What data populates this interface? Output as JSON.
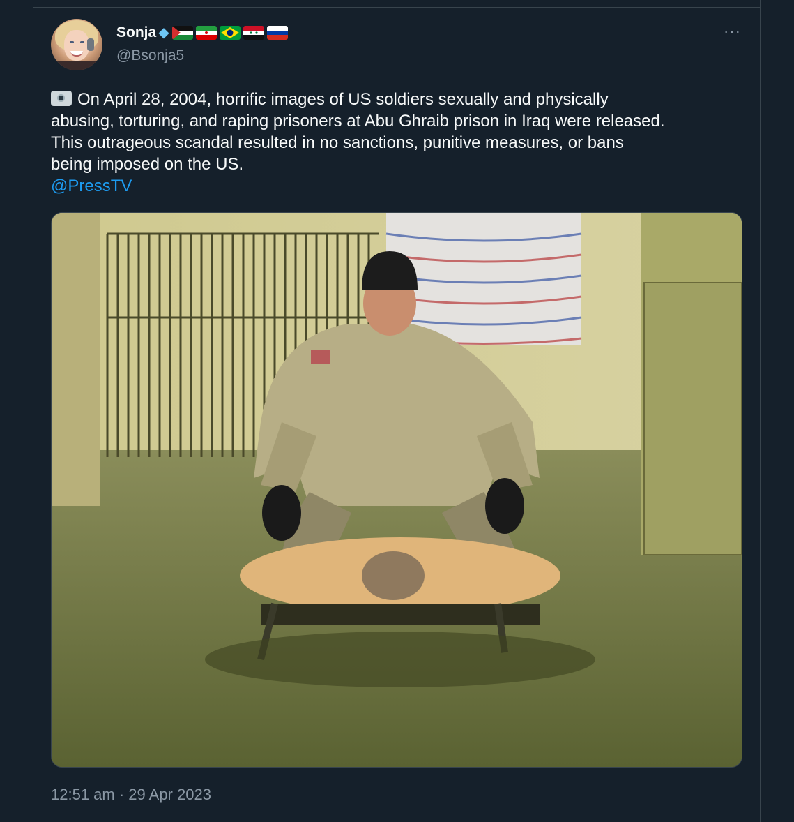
{
  "author": {
    "name": "Sonja",
    "handle": "@Bsonja5"
  },
  "more_button": "···",
  "tweet": {
    "lines": [
      "On April 28, 2004, horrific images of US soldiers sexually and physically",
      "abusing, torturing, and raping prisoners at Abu Ghraib prison in Iraq were released.",
      "This outrageous scandal resulted in no sanctions, punitive measures, or bans",
      "being imposed on the US."
    ],
    "mention": "@PressTV",
    "leading_icon": "camera-icon"
  },
  "timestamp": "12:51 am · 29 Apr 2023",
  "colors": {
    "background": "#15202b",
    "text": "#f7f9f9",
    "muted": "#8b98a5",
    "link": "#1d9bf0",
    "border": "#38444d"
  },
  "flags": [
    "palestine-flag",
    "iran-flag",
    "brazil-flag",
    "syria-flag",
    "russia-flag"
  ]
}
